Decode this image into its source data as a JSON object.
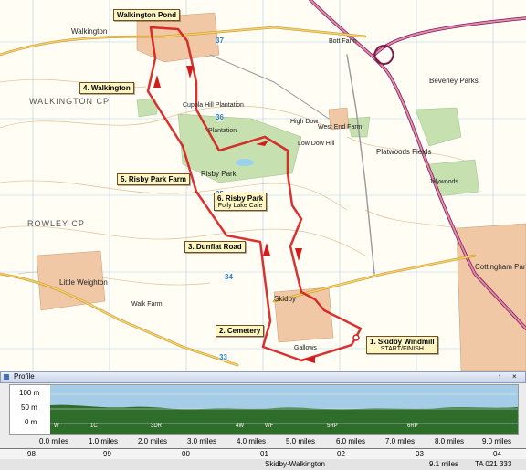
{
  "map": {
    "route_labels": {
      "walkington_pond": "Walkington Pond",
      "walkington": "4. Walkington",
      "risby_park_farm": "5. Risby Park Farm",
      "risby_park": "6. Risby Park",
      "folly_lake_cafe": "Folly Lake Cafe",
      "dunflat_road": "3. Dunflat Road",
      "cemetery": "2. Cemetery",
      "skidby_windmill": "1. Skidby Windmill",
      "start_finish": "START/FINISH"
    },
    "places": {
      "walkington_town": "Walkington",
      "walkington_cp": "WALKINGTON CP",
      "rowley_cp": "ROWLEY CP",
      "beverley_parks": "Beverley Parks",
      "risby_park_name": "Risby Park",
      "little_weighton": "Little Weighton",
      "skidby": "Skidby",
      "cottingham_parks": "Cottingham Parks",
      "high_dow": "High Dow",
      "low_dow_hill": "Low Dow Hill",
      "west_end_farm": "West End Farm",
      "plantation": "Plantation",
      "cupola_hill_plantation": "Cupola Hill Plantation",
      "walk_farm": "Walk Farm",
      "gallows_hill": "Gallows",
      "platwoods_fields": "Platwoods Fields",
      "jillywoods": "Jillywoods",
      "bott_farm": "Bott Farm"
    },
    "grid_numbers": [
      "37",
      "36",
      "35",
      "34",
      "33"
    ],
    "colors": {
      "route": "#d41c1c",
      "map_bg": "#fffdf4",
      "water": "#9bd0ee",
      "woodland": "#c6e0b0",
      "urban": "#f1c8a6"
    }
  },
  "profile": {
    "title": "Profile",
    "controls": {
      "pin": "pin-icon",
      "dock": "↑",
      "close": "×"
    },
    "y_ticks": [
      "100 m",
      "50 m",
      "0 m"
    ],
    "waypoint_markers": [
      "W",
      "1C",
      "3DR",
      "4W",
      "WF",
      "5RP",
      "6RP"
    ],
    "distance_ticks": [
      "0.0 miles",
      "1.0 miles",
      "2.0 miles",
      "3.0 miles",
      "4.0 miles",
      "5.0 miles",
      "6.0 miles",
      "7.0 miles",
      "8.0 miles",
      "9.0 miles"
    ],
    "grid_ticks": [
      "98",
      "99",
      "00",
      "01",
      "02",
      "03",
      "04"
    ],
    "colors": {
      "fill": "#2f6e2a",
      "sky": "#a6cde8"
    }
  },
  "status_bar": {
    "route_name": "Skidby-Walkington",
    "total_distance": "9.1 miles",
    "grid_ref": "TA 021 333"
  }
}
